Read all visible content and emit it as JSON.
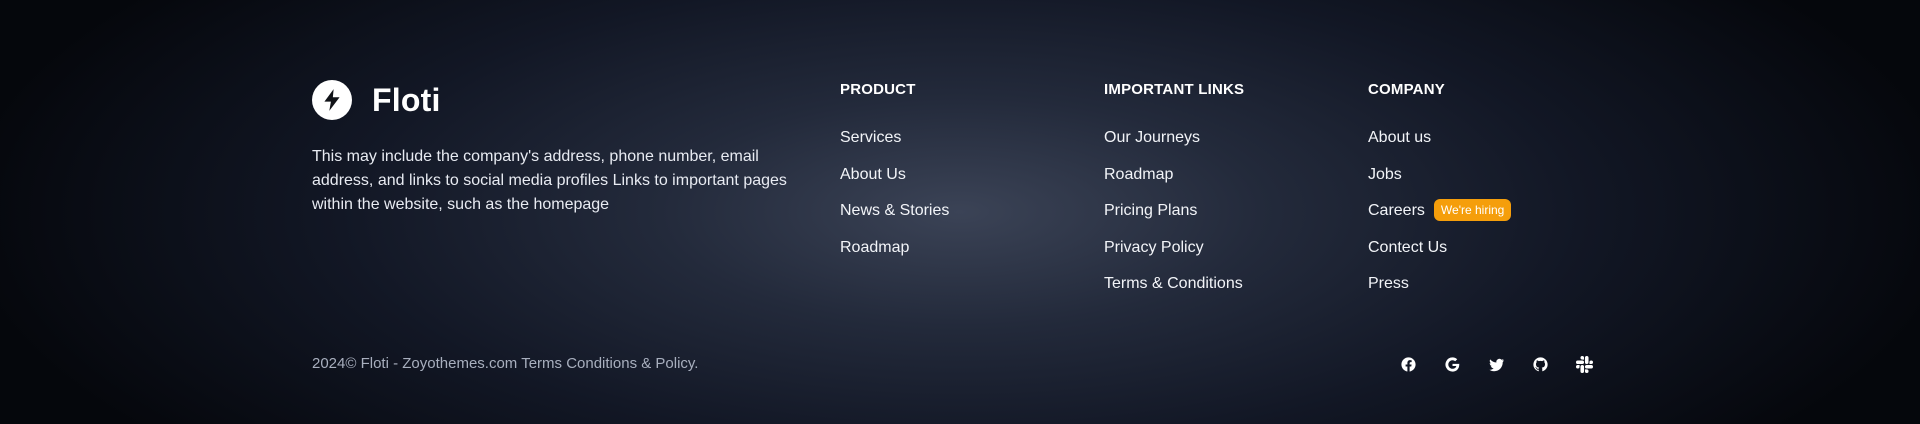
{
  "brand": {
    "name": "Floti",
    "logo_icon": "lightning-bolt-icon",
    "description": "This may include the company's address, phone number, email address, and links to social media profiles Links to important pages within the website, such as the homepage"
  },
  "columns": [
    {
      "title": "PRODUCT",
      "items": [
        "Services",
        "About Us",
        "News & Stories",
        "Roadmap"
      ]
    },
    {
      "title": "IMPORTANT LINKS",
      "items": [
        "Our Journeys",
        "Roadmap",
        "Pricing Plans",
        "Privacy Policy",
        "Terms & Conditions"
      ]
    },
    {
      "title": "COMPANY",
      "items": [
        "About us",
        "Jobs",
        "Careers",
        "Contect Us",
        "Press"
      ],
      "badge": "We're hiring"
    }
  ],
  "footer": {
    "copyright": "2024© Floti - Zoyothemes.com Terms Conditions & Policy."
  },
  "socials": [
    "facebook-icon",
    "google-icon",
    "twitter-icon",
    "github-icon",
    "slack-icon"
  ],
  "colors": {
    "badge": "#f59e0b",
    "text": "#ffffff",
    "muted": "#a8afbe"
  }
}
